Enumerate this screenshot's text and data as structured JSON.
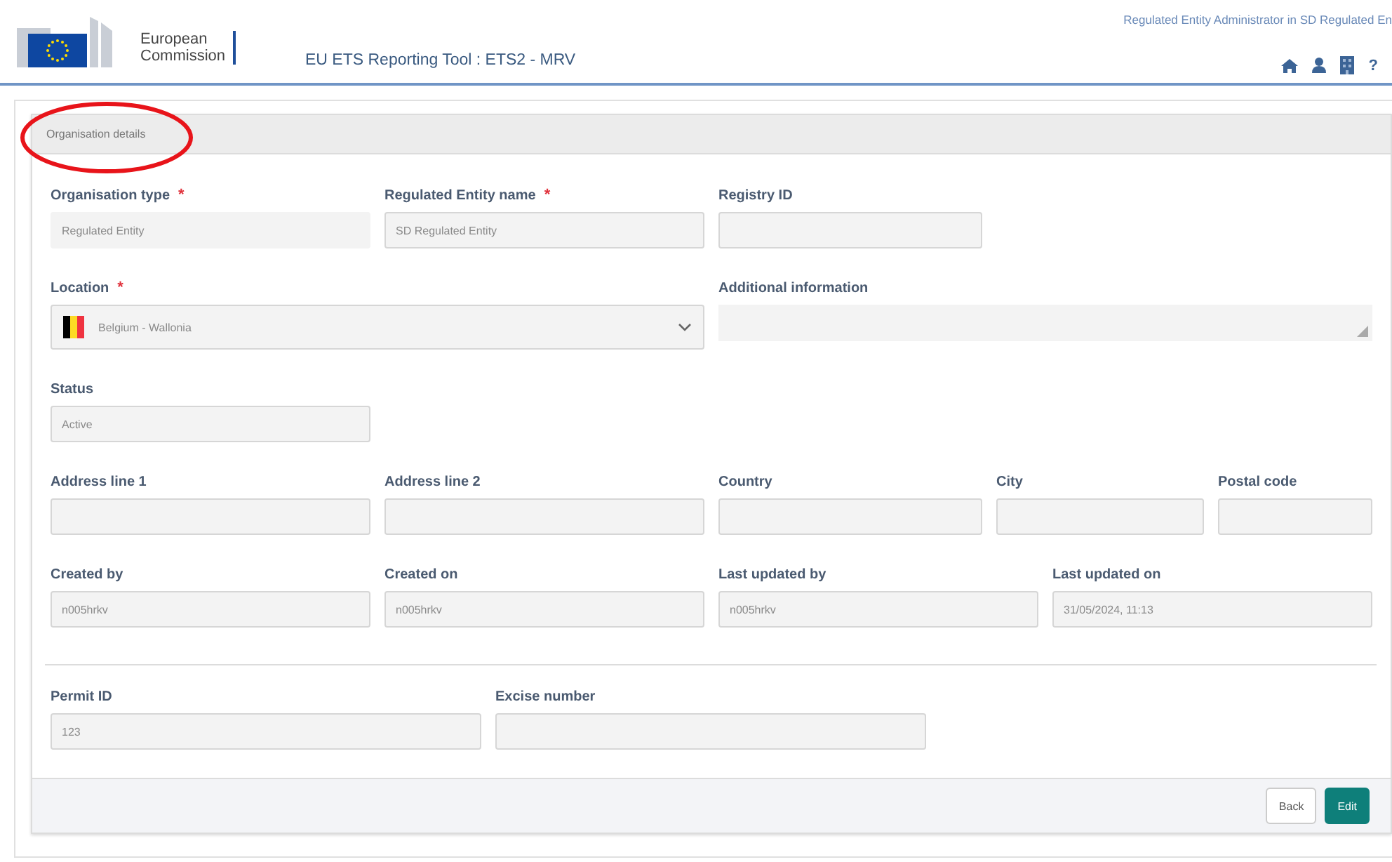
{
  "header": {
    "logo_line_1": "European",
    "logo_line_2": "Commission",
    "app_title": "EU ETS Reporting Tool : ETS2 - MRV",
    "user_role": "Regulated Entity Administrator in SD Regulated En",
    "toolbar": [
      {
        "kind": "home"
      },
      {
        "kind": "user"
      },
      {
        "kind": "building"
      },
      {
        "kind": "help",
        "label": "?"
      }
    ]
  },
  "panel": {
    "title": "Organisation details",
    "highlighted": true
  },
  "sections": [
    {
      "fields": [
        {
          "label": "Organisation type",
          "required_mark": "*",
          "kind": "static",
          "value": "Regulated Entity"
        },
        {
          "label": "Regulated Entity name",
          "required_mark": "*",
          "kind": "text",
          "value": "SD Regulated Entity"
        },
        {
          "label": "Registry ID",
          "kind": "text"
        },
        {
          "label": "Location",
          "required_mark": "*",
          "kind": "select",
          "value": "Belgium - Wallonia"
        },
        {
          "label": "Additional information",
          "kind": "textarea"
        },
        {
          "label": "Status",
          "kind": "text",
          "value": "Active"
        },
        {
          "label": "Address line 1",
          "kind": "text"
        },
        {
          "label": "Address line 2",
          "kind": "text"
        },
        {
          "label": "Country",
          "kind": "text"
        },
        {
          "label": "City",
          "kind": "text"
        },
        {
          "label": "Postal code",
          "kind": "text"
        },
        {
          "label": "Created by",
          "kind": "text",
          "value": "n005hrkv"
        },
        {
          "label": "Created on",
          "kind": "text",
          "value": "n005hrkv"
        },
        {
          "label": "Last updated by",
          "kind": "text",
          "value": "n005hrkv"
        },
        {
          "label": "Last updated on",
          "kind": "text",
          "value": "31/05/2024, 11:13"
        }
      ]
    },
    {
      "fields": [
        {
          "label": "Permit ID",
          "kind": "text",
          "value": "123"
        },
        {
          "label": "Excise number",
          "kind": "text"
        }
      ]
    }
  ],
  "buttons": [
    {
      "label": "Back",
      "kind": "secondary"
    },
    {
      "label": "Edit",
      "kind": "primary"
    }
  ]
}
